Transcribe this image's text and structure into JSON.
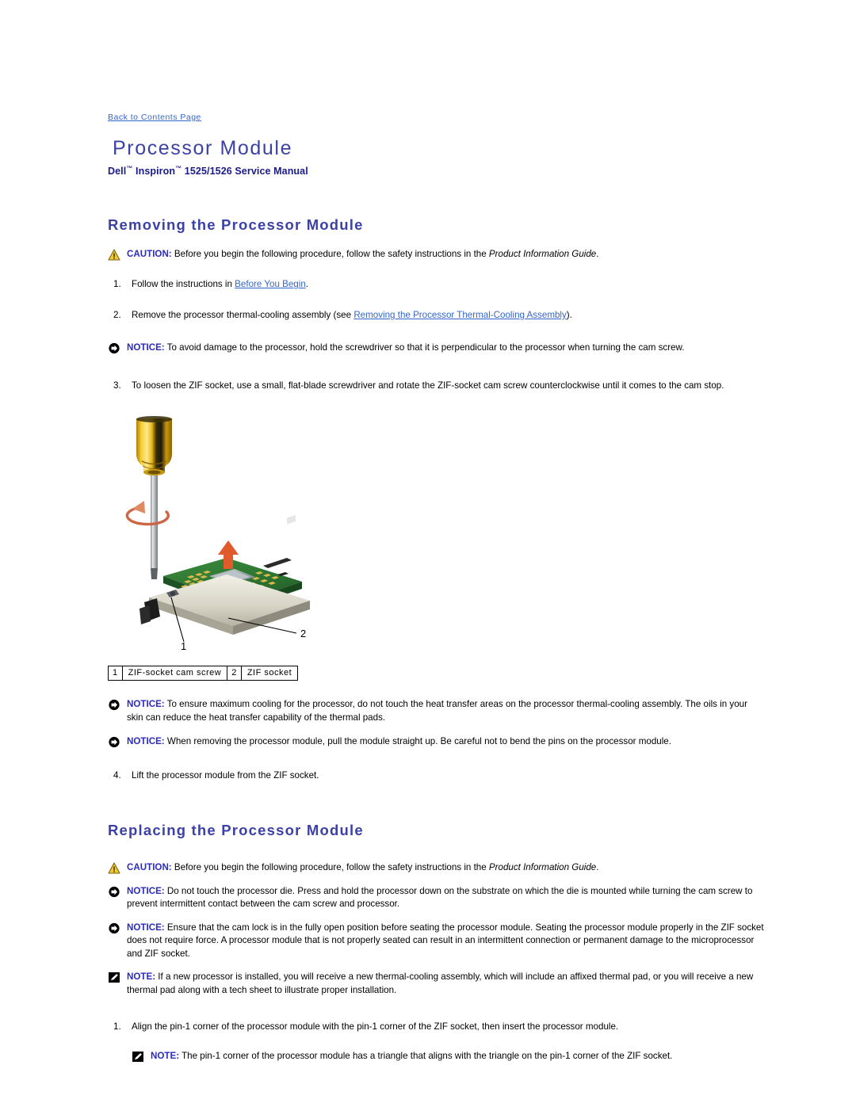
{
  "header": {
    "back_link": "Back to Contents Page",
    "title": "Processor Module",
    "subtitle_pre": "Dell",
    "subtitle_tm1": "™",
    "subtitle_mid": " Inspiron",
    "subtitle_tm2": "™",
    "subtitle_post": " 1525/1526 Service Manual"
  },
  "removing": {
    "heading": "Removing the Processor Module",
    "caution": {
      "label": "CAUTION:",
      "text_a": " Before you begin the following procedure, follow the safety instructions in the ",
      "italic": "Product Information Guide",
      "text_b": "."
    },
    "step1": {
      "num": "1.",
      "text_a": "Follow the instructions in ",
      "link": "Before You Begin",
      "text_b": "."
    },
    "step2": {
      "num": "2.",
      "text_a": "Remove the processor thermal-cooling assembly (see ",
      "link": "Removing the Processor Thermal-Cooling Assembly",
      "text_b": ")."
    },
    "notice1": {
      "label": "NOTICE:",
      "text": " To avoid damage to the processor, hold the screwdriver so that it is perpendicular to the processor when turning the cam screw."
    },
    "step3": {
      "num": "3.",
      "text": "To loosen the ZIF socket, use a small, flat-blade screwdriver and rotate the ZIF-socket cam screw counterclockwise until it comes to the cam stop."
    },
    "figure": {
      "alt": "Screwdriver turning the ZIF-socket cam screw on the processor module",
      "callout_1": "1",
      "callout_2": "2"
    },
    "legend": [
      {
        "key": "1",
        "value": "ZIF-socket cam screw"
      },
      {
        "key": "2",
        "value": "ZIF socket"
      }
    ],
    "notice2": {
      "label": "NOTICE:",
      "text": " To ensure maximum cooling for the processor, do not touch the heat transfer areas on the processor thermal-cooling assembly. The oils in your skin can reduce the heat transfer capability of the thermal pads."
    },
    "notice3": {
      "label": "NOTICE:",
      "text": " When removing the processor module, pull the module straight up. Be careful not to bend the pins on the processor module."
    },
    "step4": {
      "num": "4.",
      "text": "Lift the processor module from the ZIF socket."
    }
  },
  "replacing": {
    "heading": "Replacing the Processor Module",
    "caution": {
      "label": "CAUTION:",
      "text_a": " Before you begin the following procedure, follow the safety instructions in the ",
      "italic": "Product Information Guide",
      "text_b": "."
    },
    "notice1": {
      "label": "NOTICE:",
      "text": " Do not touch the processor die. Press and hold the processor down on the substrate on which the die is mounted while turning the cam screw to prevent intermittent contact between the cam screw and processor."
    },
    "notice2": {
      "label": "NOTICE:",
      "text": " Ensure that the cam lock is in the fully open position before seating the processor module. Seating the processor module properly in the ZIF socket does not require force. A processor module that is not properly seated can result in an intermittent connection or permanent damage to the microprocessor and ZIF socket."
    },
    "note1": {
      "label": "NOTE:",
      "text": " If a new processor is installed, you will receive a new thermal-cooling assembly, which will include an affixed thermal pad, or you will receive a new thermal pad along with a tech sheet to illustrate proper installation."
    },
    "step1": {
      "num": "1.",
      "text": "Align the pin-1 corner of the processor module with the pin-1 corner of the ZIF socket, then insert the processor module."
    },
    "note2": {
      "label": "NOTE:",
      "text": " The pin-1 corner of the processor module has a triangle that aligns with the triangle on the pin-1 corner of the ZIF socket."
    }
  },
  "icons": {
    "caution": "warning-triangle-icon",
    "notice": "notice-arrow-icon",
    "note": "note-pencil-icon"
  },
  "colors": {
    "heading_blue": "#3c41a6",
    "link_blue": "#3366cc",
    "label_blue": "#2b2bc0",
    "caution_yellow": "#f2c832",
    "page_background": "#ffffff"
  }
}
